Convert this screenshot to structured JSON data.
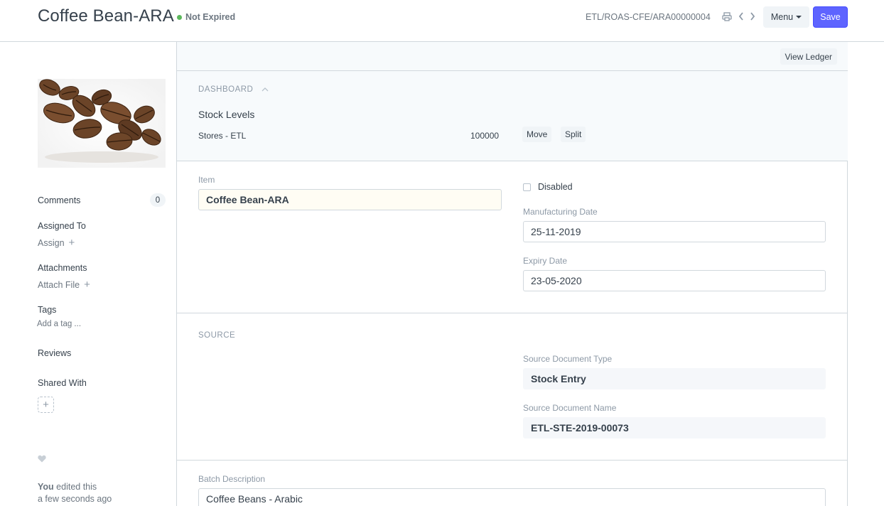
{
  "header": {
    "title": "Coffee Bean-ARA",
    "status": "Not Expired",
    "doc_name": "ETL/ROAS-CFE/ARA00000004",
    "menu_label": "Menu",
    "save_label": "Save",
    "status_color": "#5cb85c",
    "primary_color": "#5e64ff"
  },
  "sidebar": {
    "comments_label": "Comments",
    "comments_count": "0",
    "assigned_to_label": "Assigned To",
    "assign_link": "Assign",
    "attachments_label": "Attachments",
    "attach_link": "Attach File",
    "tags_label": "Tags",
    "add_tag_link": "Add a tag ...",
    "reviews_label": "Reviews",
    "shared_with_label": "Shared With",
    "edited_by": "You",
    "edited_text": "edited this",
    "edited_time": "a few seconds ago"
  },
  "toolbar": {
    "view_ledger_label": "View Ledger"
  },
  "dashboard": {
    "heading": "DASHBOARD",
    "stock_title": "Stock Levels",
    "warehouse": "Stores - ETL",
    "quantity": "100000",
    "move_label": "Move",
    "split_label": "Split"
  },
  "details": {
    "item_label": "Item",
    "item_value": "Coffee Bean-ARA",
    "disabled_label": "Disabled",
    "mfg_date_label": "Manufacturing Date",
    "mfg_date_value": "25-11-2019",
    "expiry_date_label": "Expiry Date",
    "expiry_date_value": "23-05-2020"
  },
  "source": {
    "heading": "SOURCE",
    "doc_type_label": "Source Document Type",
    "doc_type_value": "Stock Entry",
    "doc_name_label": "Source Document Name",
    "doc_name_value": "ETL-STE-2019-00073"
  },
  "description": {
    "label": "Batch Description",
    "value": "Coffee Beans - Arabic"
  }
}
